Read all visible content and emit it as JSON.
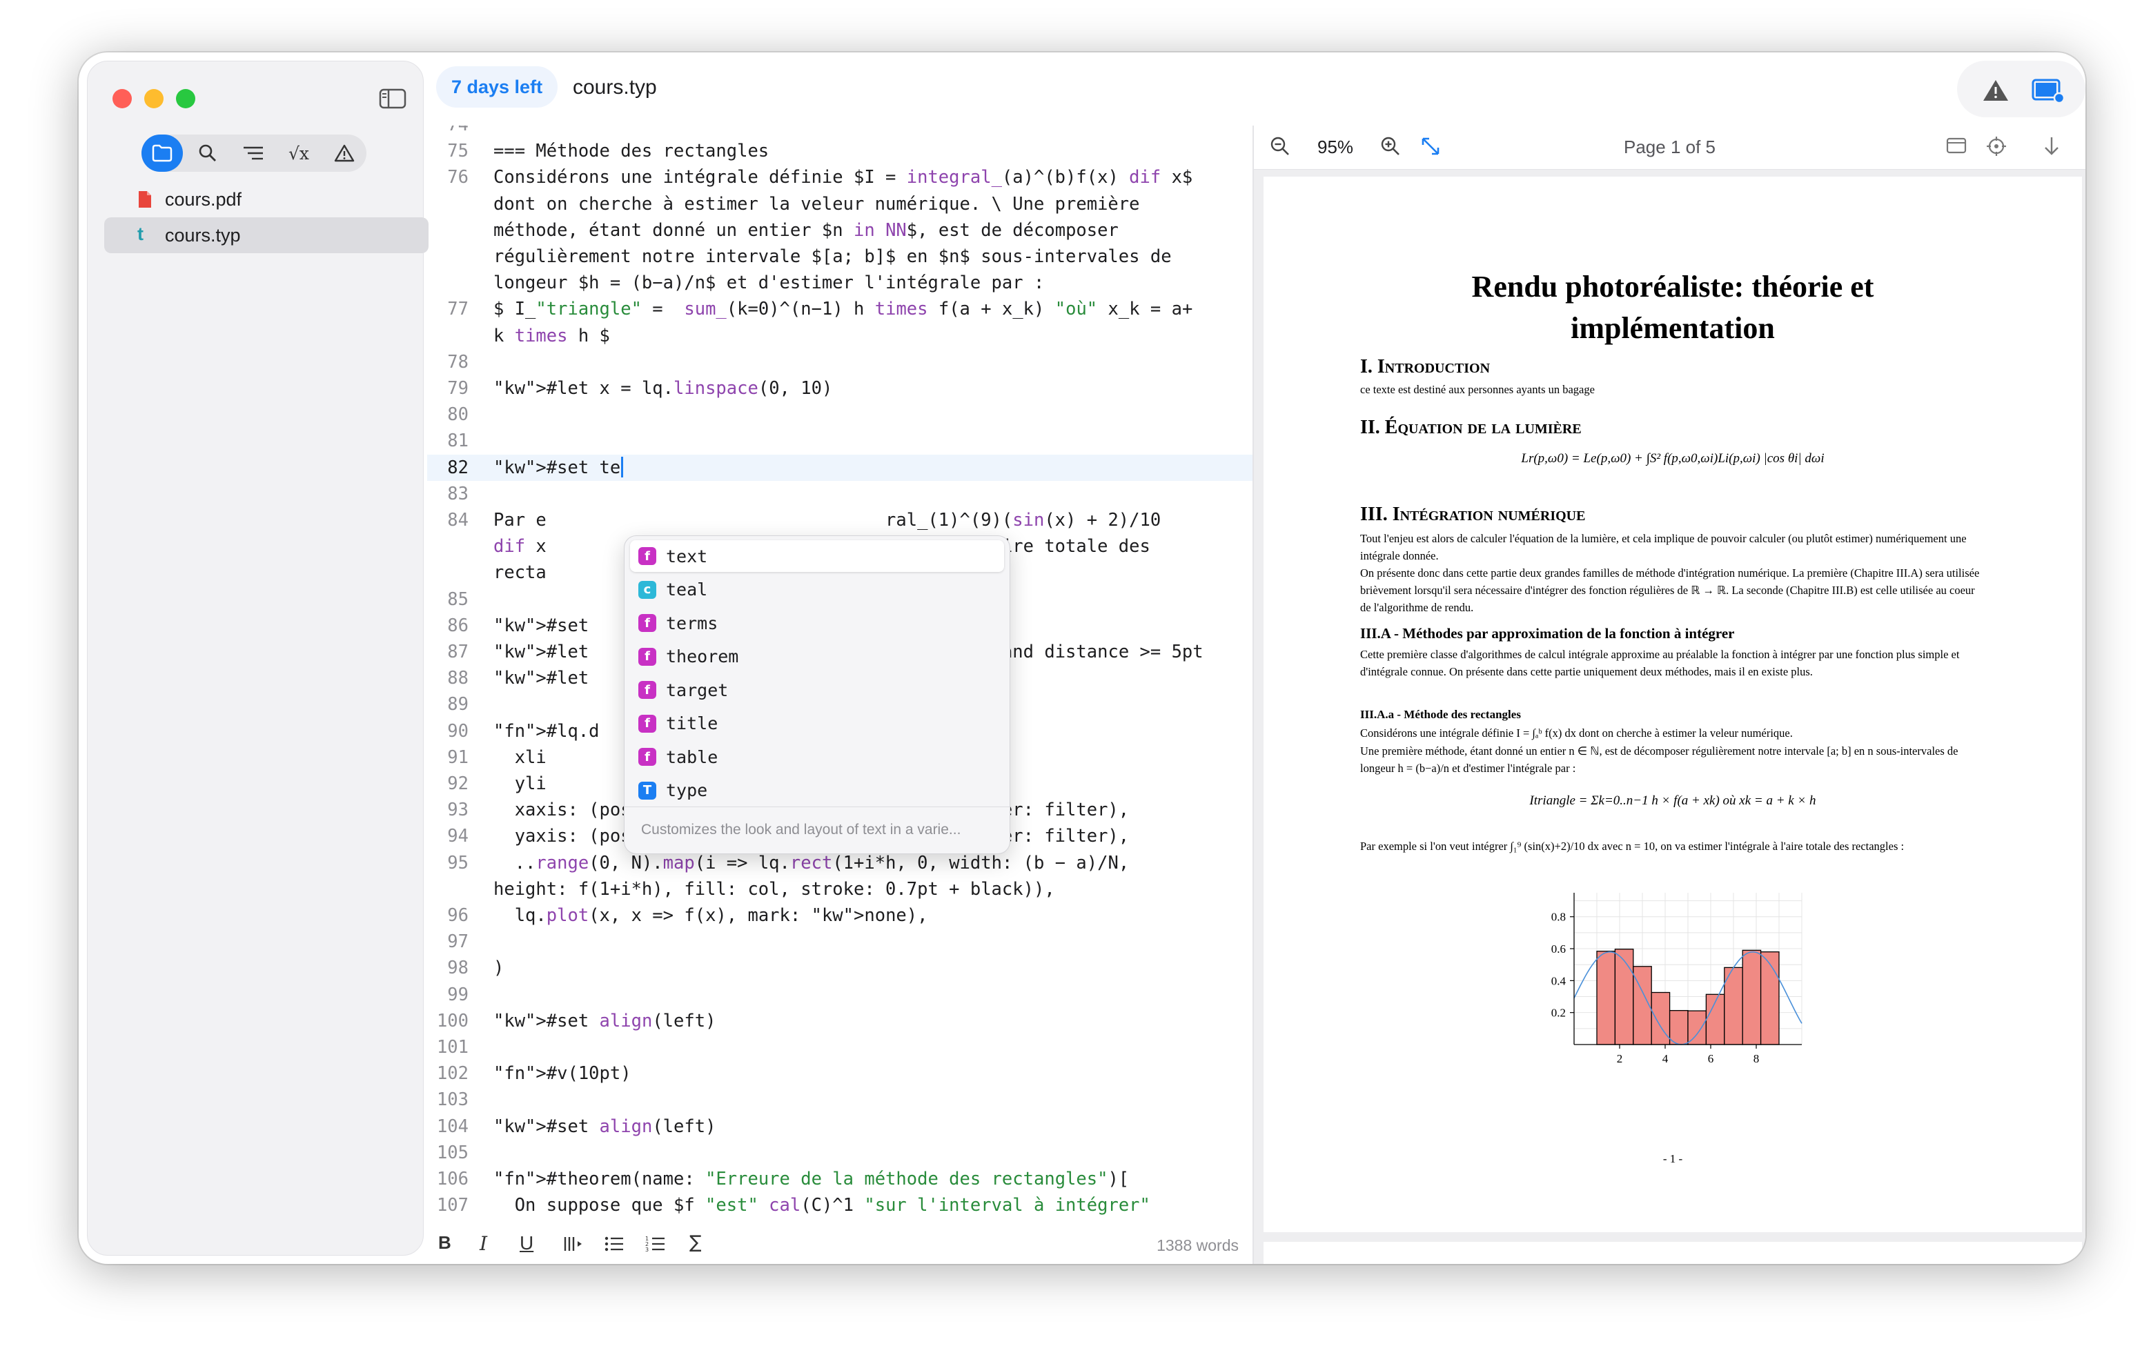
{
  "window": {
    "trial_badge": "7 days left",
    "document_title": "cours.typ"
  },
  "sidebar": {
    "tools": [
      "folder-icon",
      "search-icon",
      "outline-icon",
      "math-icon",
      "warning-icon"
    ],
    "tool_labels": [
      "",
      "",
      "",
      "√x",
      ""
    ],
    "files": [
      {
        "name": "cours.pdf",
        "icon": "pdf-file-icon"
      },
      {
        "name": "cours.typ",
        "icon": "typst-file-icon",
        "selected": true
      }
    ]
  },
  "editor": {
    "lines": [
      {
        "n": "74",
        "text": ""
      },
      {
        "n": "75",
        "text": "=== Méthode des rectangles"
      },
      {
        "n": "76",
        "text": "Considérons une intégrale définie $I = integral_(a)^(b)f(x) dif x$"
      },
      {
        "n": "",
        "text": "dont on cherche à estimer la veleur numérique. \\ Une première"
      },
      {
        "n": "",
        "text": "méthode, étant donné un entier $n in NN$, est de décomposer"
      },
      {
        "n": "",
        "text": "régulièrement notre intervale $[a; b]$ en $n$ sous-intervales de"
      },
      {
        "n": "",
        "text": "longeur $h = (b−a)/n$ et d'estimer l'intégrale par :"
      },
      {
        "n": "77",
        "text": "$ I_\"triangle\" =  sum_(k=0)^(n−1) h times f(a + x_k) \"où\" x_k = a+"
      },
      {
        "n": "",
        "text": "k times h $"
      },
      {
        "n": "78",
        "text": ""
      },
      {
        "n": "79",
        "text": "#let x = lq.linspace(0, 10)"
      },
      {
        "n": "80",
        "text": ""
      },
      {
        "n": "81",
        "text": ""
      },
      {
        "n": "82",
        "text": "#set te"
      },
      {
        "n": "83",
        "text": ""
      },
      {
        "n": "84",
        "text": "Par e                                ral_(1)^(9)(sin(x) + 2)/10"
      },
      {
        "n": "",
        "text": "dif x                                grale à l'aire totale des"
      },
      {
        "n": "",
        "text": "recta"
      },
      {
        "n": "85",
        "text": ""
      },
      {
        "n": "86",
        "text": "#set"
      },
      {
        "n": "87",
        "text": "#let                                0 and distance >= 5pt"
      },
      {
        "n": "88",
        "text": "#let"
      },
      {
        "n": "89",
        "text": ""
      },
      {
        "n": "90",
        "text": "#lq.d"
      },
      {
        "n": "91",
        "text": "  xli"
      },
      {
        "n": "92",
        "text": "  yli"
      },
      {
        "n": "93",
        "text": "  xaxis: (position: 0, tip: tiptoe.stealth, filter: filter),"
      },
      {
        "n": "94",
        "text": "  yaxis: (position: 0, tip: tiptoe.stealth, filter: filter),"
      },
      {
        "n": "95",
        "text": "  ..range(0, N).map(i => lq.rect(1+i*h, 0, width: (b − a)/N,"
      },
      {
        "n": "",
        "text": "height: f(1+i*h), fill: col, stroke: 0.7pt + black)),"
      },
      {
        "n": "96",
        "text": "  lq.plot(x, x => f(x), mark: none),"
      },
      {
        "n": "97",
        "text": ""
      },
      {
        "n": "98",
        "text": ")"
      },
      {
        "n": "99",
        "text": ""
      },
      {
        "n": "100",
        "text": "#set align(left)"
      },
      {
        "n": "101",
        "text": ""
      },
      {
        "n": "102",
        "text": "#v(10pt)"
      },
      {
        "n": "103",
        "text": ""
      },
      {
        "n": "104",
        "text": "#set align(left)"
      },
      {
        "n": "105",
        "text": ""
      },
      {
        "n": "106",
        "text": "#theorem(name: \"Erreure de la méthode des rectangles\")["
      },
      {
        "n": "107",
        "text": "  On suppose que $f \"est\" cal(C)^1 \"sur l'interval à intégrer\""
      }
    ],
    "autocomplete": {
      "items": [
        {
          "kind": "f",
          "label": "text",
          "selected": true
        },
        {
          "kind": "c",
          "label": "teal"
        },
        {
          "kind": "f",
          "label": "terms"
        },
        {
          "kind": "f",
          "label": "theorem"
        },
        {
          "kind": "f",
          "label": "target"
        },
        {
          "kind": "f",
          "label": "title"
        },
        {
          "kind": "f",
          "label": "table"
        },
        {
          "kind": "t",
          "label": "type"
        }
      ],
      "help": "Customizes the look and layout of text in a varie..."
    },
    "format_bar": {
      "bold": "B",
      "italic": "I",
      "underline": "U",
      "math": "∑",
      "word_count": "1388 words"
    }
  },
  "preview": {
    "zoom": "95%",
    "page_info": "Page 1 of 5",
    "document": {
      "title_line1": "Rendu photoréaliste: théorie et",
      "title_line2": "implémentation",
      "s1": "I. Introduction",
      "s1_text": "ce texte est destiné aux personnes ayants un bagage",
      "s2": "II. Équation de la lumière",
      "s2_eq": "Lr(p,ω0) = Le(p,ω0) + ∫S² f(p,ω0,ωi)Li(p,ωi) |cos θi| dωi",
      "s3": "III. Intégration numérique",
      "s3_p1": "Tout l'enjeu est alors de calculer l'équation de la lumière, et cela implique de pouvoir calculer (ou plutôt estimer) numériquement une intégrale donnée.",
      "s3_p2": "On présente donc dans cette partie deux grandes familles de méthode d'intégration numérique. La première (Chapitre III.A) sera utilisée brièvement lorsqu'il sera nécessaire d'intégrer des fonction régulières de ℝ → ℝ. La seconde (Chapitre III.B) est celle utilisée au coeur de l'algorithme de rendu.",
      "s3a": "III.A - Méthodes par approximation de la fonction à intégrer",
      "s3a_p": "Cette première classe d'algorithmes de calcul intégrale approxime au préalable la fonction à intégrer par une fonction plus simple et d'intégrale connue. On présente dans cette partie uniquement deux méthodes, mais il en existe plus.",
      "s3aa": "III.A.a - Méthode des rectangles",
      "s3aa_p1": "Considérons une intégrale définie I = ∫ₐᵇ f(x) dx dont on cherche à estimer la veleur numérique.",
      "s3aa_p2": "Une première méthode, étant donné un entier n ∈ ℕ, est de décomposer régulièrement notre intervale [a; b] en n sous-intervales de longeur h = (b−a)/n et d'estimer l'intégrale par :",
      "s3aa_eq": "Itriangle = Σk=0..n−1 h × f(a + xk) où xk = a + k × h",
      "s3aa_p3": "Par exemple si l'on veut intégrer ∫₁⁹ (sin(x)+2)/10 dx avec n = 10, on va estimer l'intégrale à l'aire totale des rectangles :",
      "footer": "- 1 -"
    }
  },
  "chart_data": {
    "type": "bar",
    "title": "",
    "xlabel": "",
    "ylabel": "",
    "x_ticks": [
      "2",
      "4",
      "6",
      "8"
    ],
    "y_ticks": [
      "0.2",
      "0.4",
      "0.6",
      "0.8"
    ],
    "xlim": [
      0,
      10
    ],
    "ylim": [
      0,
      0.95
    ],
    "grid": true,
    "rect_width": 0.8,
    "rect_left": [
      1,
      1.8,
      2.6,
      3.4,
      4.2,
      5.0,
      5.8,
      6.6,
      7.4,
      8.2
    ],
    "rect_height": [
      0.584,
      0.597,
      0.489,
      0.326,
      0.213,
      0.211,
      0.314,
      0.482,
      0.59,
      0.58
    ],
    "curve": "(sin(x) + 2)/10",
    "bar_color": "#f08a84",
    "curve_color": "#4a90d9"
  }
}
